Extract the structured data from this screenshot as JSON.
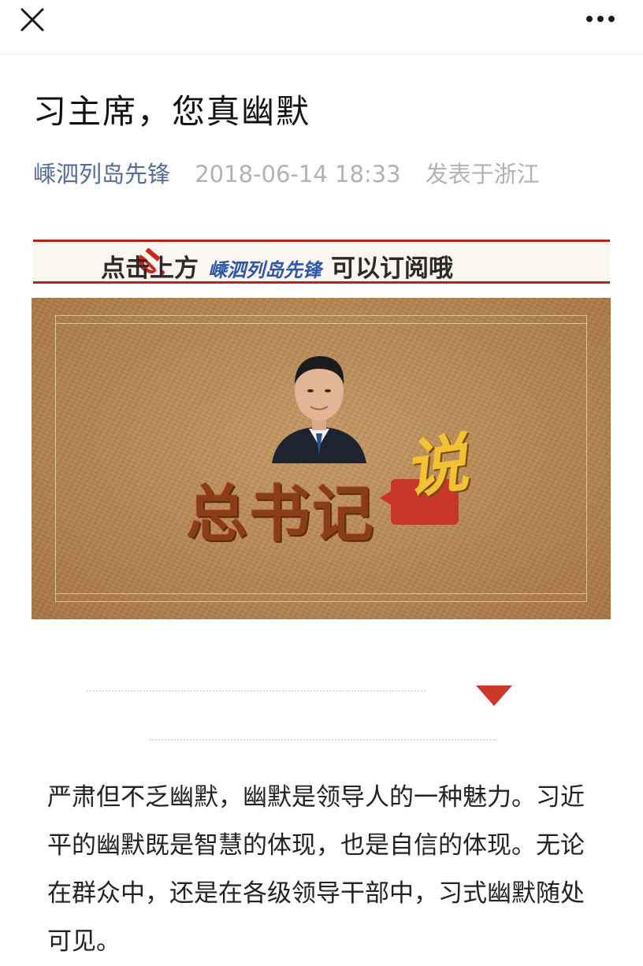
{
  "header": {
    "close_icon": "close-icon",
    "more_icon": "more-dots-icon"
  },
  "article": {
    "title": "习主席，您真幽默",
    "author": "嵊泗列岛先锋",
    "date": "2018-06-14 18:33",
    "location": "发表于浙江"
  },
  "banner": {
    "prefix": "点击上方",
    "brand": "嵊泗列岛先锋",
    "suffix": "可以订阅哦",
    "emblem_icon": "hammer-sickle-icon"
  },
  "hero": {
    "title": "总书记",
    "accent": "说"
  },
  "divider": {
    "triangle_icon": "down-triangle-icon",
    "accent_color": "#d0372b"
  },
  "body": {
    "paragraph": "严肃但不乏幽默，幽默是领导人的一种魅力。习近平的幽默既是智慧的体现，也是自信的体现。无论在群众中，还是在各级领导干部中，习式幽默随处可见。"
  },
  "colors": {
    "link": "#576b95",
    "muted": "#b2b2b2",
    "banner_red": "#b3261e",
    "hero_bg": "#bb8a56"
  }
}
